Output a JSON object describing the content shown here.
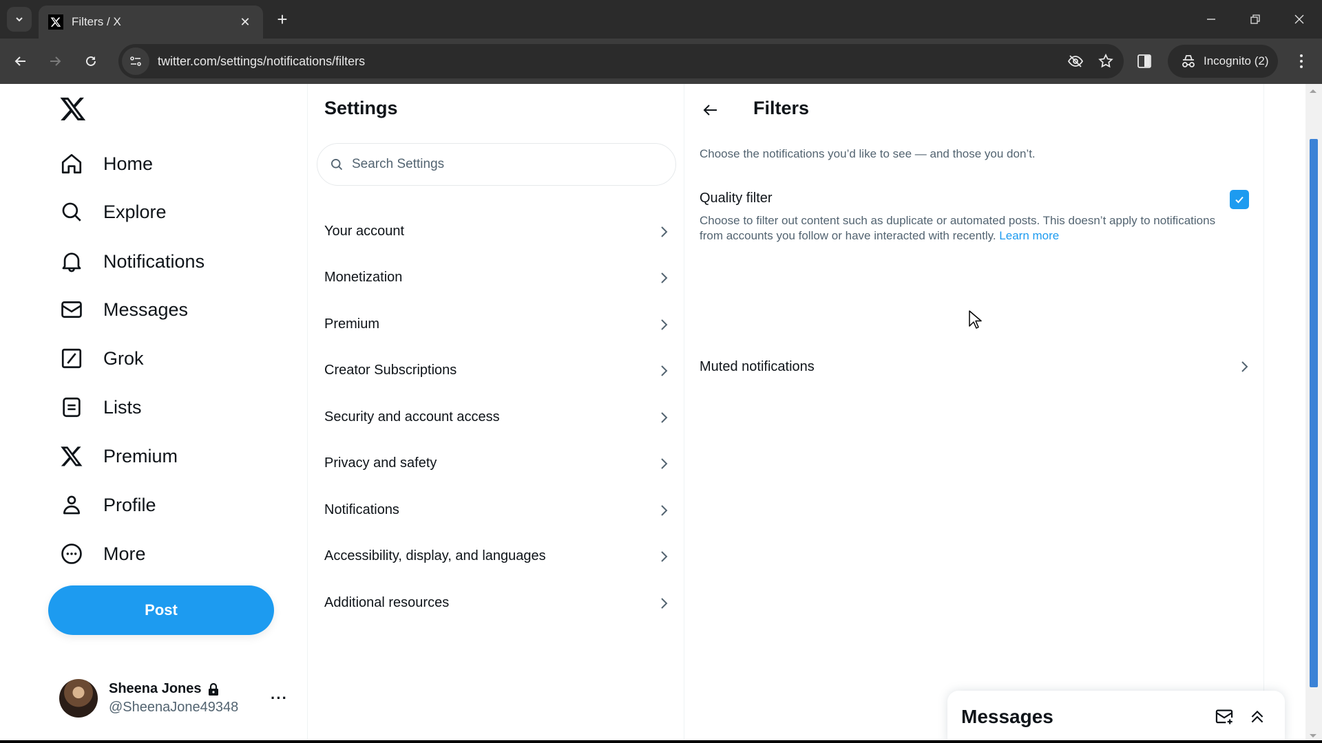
{
  "browser": {
    "tab_title": "Filters / X",
    "url": "twitter.com/settings/notifications/filters",
    "profile_label": "Incognito (2)"
  },
  "nav": {
    "items": [
      {
        "label": "Home",
        "icon": "home-icon"
      },
      {
        "label": "Explore",
        "icon": "search-icon"
      },
      {
        "label": "Notifications",
        "icon": "bell-icon"
      },
      {
        "label": "Messages",
        "icon": "envelope-icon"
      },
      {
        "label": "Grok",
        "icon": "grok-icon"
      },
      {
        "label": "Lists",
        "icon": "list-icon"
      },
      {
        "label": "Premium",
        "icon": "x-logo-icon"
      },
      {
        "label": "Profile",
        "icon": "person-icon"
      },
      {
        "label": "More",
        "icon": "more-circle-icon"
      }
    ],
    "post_label": "Post",
    "account": {
      "name": "Sheena Jones",
      "handle": "@SheenaJone49348",
      "protected": true
    }
  },
  "settings": {
    "title": "Settings",
    "search_placeholder": "Search Settings",
    "items": [
      "Your account",
      "Monetization",
      "Premium",
      "Creator Subscriptions",
      "Security and account access",
      "Privacy and safety",
      "Notifications",
      "Accessibility, display, and languages",
      "Additional resources"
    ]
  },
  "filters": {
    "title": "Filters",
    "description": "Choose the notifications you’d like to see — and those you don’t.",
    "quality_filter": {
      "title": "Quality filter",
      "description": "Choose to filter out content such as duplicate or automated posts. This doesn’t apply to notifications from accounts you follow or have interacted with recently.",
      "link": "Learn more",
      "checked": true
    },
    "muted_notifications": "Muted notifications"
  },
  "messages_drawer": {
    "title": "Messages"
  },
  "colors": {
    "accent": "#1d9bf0",
    "text": "#0f1419",
    "secondary_text": "#536471"
  }
}
